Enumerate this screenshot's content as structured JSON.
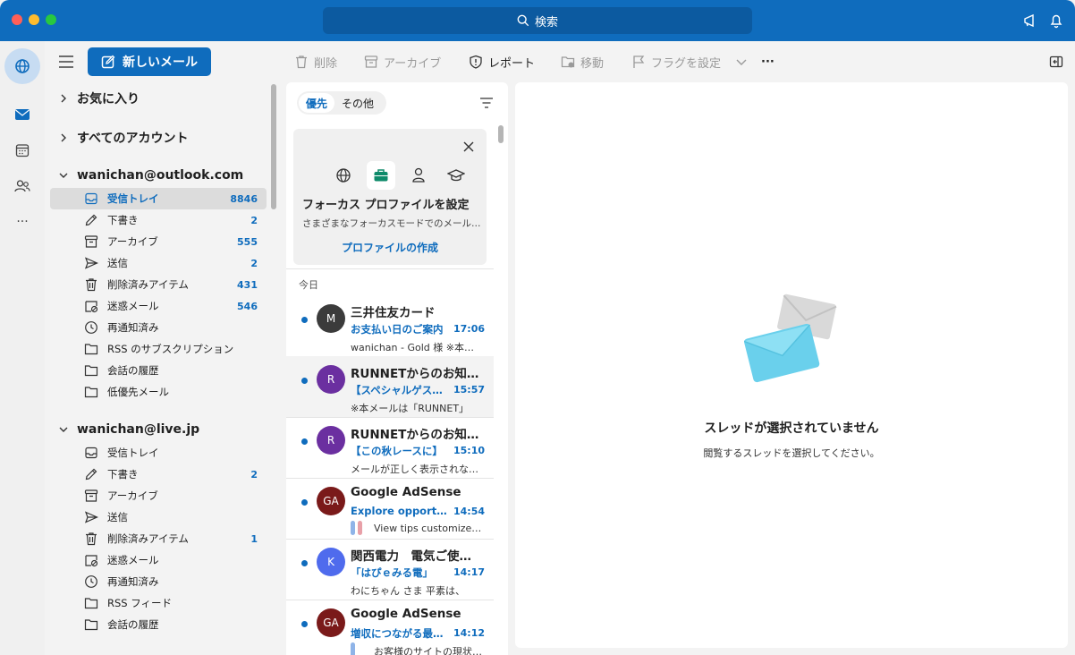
{
  "titlebar": {
    "search_label": "検索"
  },
  "toolbar": {
    "new_mail": "新しいメール",
    "delete": "削除",
    "archive": "アーカイブ",
    "report": "レポート",
    "move": "移動",
    "flag": "フラグを設定",
    "more": "···"
  },
  "folders": {
    "favorites": "お気に入り",
    "all_accounts": "すべてのアカウント",
    "accounts": [
      {
        "email": "wanichan@outlook.com",
        "items": [
          {
            "label": "受信トレイ",
            "count": "8846",
            "icon": "inbox-icon"
          },
          {
            "label": "下書き",
            "count": "2",
            "icon": "pencil-icon"
          },
          {
            "label": "アーカイブ",
            "count": "555",
            "icon": "archive-icon"
          },
          {
            "label": "送信",
            "count": "2",
            "icon": "send-icon"
          },
          {
            "label": "削除済みアイテム",
            "count": "431",
            "icon": "trash-icon"
          },
          {
            "label": "迷惑メール",
            "count": "546",
            "icon": "junk-icon"
          },
          {
            "label": "再通知済み",
            "count": "",
            "icon": "clock-icon"
          },
          {
            "label": "RSS のサブスクリプション",
            "count": "",
            "icon": "folder-icon"
          },
          {
            "label": "会話の履歴",
            "count": "",
            "icon": "folder-icon"
          },
          {
            "label": "低優先メール",
            "count": "",
            "icon": "folder-icon"
          }
        ]
      },
      {
        "email": "wanichan@live.jp",
        "items": [
          {
            "label": "受信トレイ",
            "count": "",
            "icon": "inbox-icon"
          },
          {
            "label": "下書き",
            "count": "2",
            "icon": "pencil-icon"
          },
          {
            "label": "アーカイブ",
            "count": "",
            "icon": "archive-icon"
          },
          {
            "label": "送信",
            "count": "",
            "icon": "send-icon"
          },
          {
            "label": "削除済みアイテム",
            "count": "1",
            "icon": "trash-icon"
          },
          {
            "label": "迷惑メール",
            "count": "",
            "icon": "junk-icon"
          },
          {
            "label": "再通知済み",
            "count": "",
            "icon": "clock-icon"
          },
          {
            "label": "RSS フィード",
            "count": "",
            "icon": "folder-icon"
          },
          {
            "label": "会話の履歴",
            "count": "",
            "icon": "folder-icon"
          }
        ]
      }
    ]
  },
  "list": {
    "tab_focused": "優先",
    "tab_other": "その他",
    "promo_title": "フォーカス プロファイルを設定",
    "promo_sub": "さまざまなフォーカスモードでのメール管理",
    "promo_link": "プロファイルの作成",
    "section_today": "今日",
    "messages": [
      {
        "initials": "M",
        "color": "#3b3b3b",
        "sender": "三井住友カード",
        "subject": "お支払い日のご案内",
        "time": "17:06",
        "preview": "wanichan - Gold 様 ※本メールは",
        "tags": []
      },
      {
        "initials": "R",
        "color": "#6b2fa0",
        "sender": "RUNNETからのお知らせ",
        "subject": "【スペシャルゲスト】",
        "time": "15:57",
        "preview": "※本メールは「RUNNET」",
        "tags": []
      },
      {
        "initials": "R",
        "color": "#6b2fa0",
        "sender": "RUNNETからのお知らせ",
        "subject": "【この秋レースに】",
        "time": "15:10",
        "preview": "メールが正しく表示されない場合",
        "tags": []
      },
      {
        "initials": "GA",
        "color": "#7a1a1a",
        "sender": "Google AdSense",
        "subject": "Explore opportunities",
        "time": "14:54",
        "preview": "View tips customized for you",
        "tags": [
          "#8fb4e8",
          "#e8a0a8"
        ]
      },
      {
        "initials": "K",
        "color": "#4f6bed",
        "sender": "関西電力　電気ご使用量のお知らせ",
        "subject": "「はぴｅみる電」",
        "time": "14:17",
        "preview": "わにちゃん さま 平素は、",
        "tags": []
      },
      {
        "initials": "GA",
        "color": "#7a1a1a",
        "sender": "Google AdSense",
        "subject": "増収につながる最適化案",
        "time": "14:12",
        "preview": "お客様のサイトの現状分析",
        "tags": [
          "#8fb4e8"
        ]
      }
    ]
  },
  "reading": {
    "empty_title": "スレッドが選択されていません",
    "empty_sub": "閲覧するスレッドを選択してください。"
  },
  "colors": {
    "brand": "#0f6cbd",
    "unread_dot": "#0f6cbd"
  }
}
